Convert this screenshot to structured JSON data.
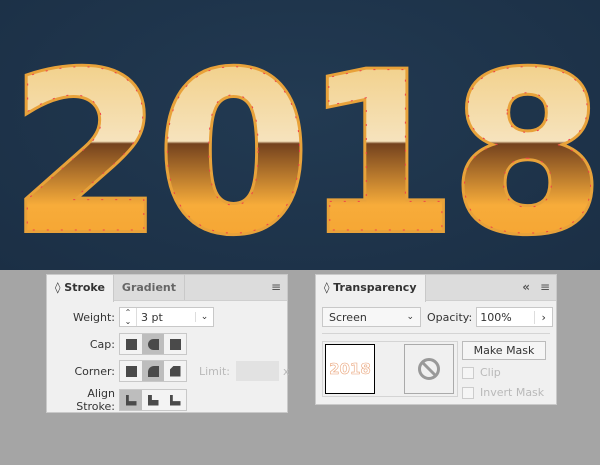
{
  "artwork": {
    "text": "2018",
    "colors": {
      "background": "#1c3149",
      "top": "#f6e2b8",
      "bottom": "#f7a833",
      "band": "#7b4a22",
      "anchor": "#f0404a"
    }
  },
  "stroke_panel": {
    "tabs": [
      {
        "label": "Stroke"
      },
      {
        "label": "Gradient"
      }
    ],
    "weight_label": "Weight:",
    "weight_value": "3 pt",
    "cap_label": "Cap:",
    "corner_label": "Corner:",
    "limit_label": "Limit:",
    "limit_unit": "x",
    "align_label": "Align Stroke:",
    "cap_selected": "round-cap",
    "corner_selected": "round-join",
    "align_selected": "align-center"
  },
  "transparency_panel": {
    "title": "Transparency",
    "blend_mode": "Screen",
    "opacity_label": "Opacity:",
    "opacity_value": "100%",
    "thumbnail_text": "2018",
    "make_mask_label": "Make Mask",
    "clip_label": "Clip",
    "invert_mask_label": "Invert Mask"
  }
}
